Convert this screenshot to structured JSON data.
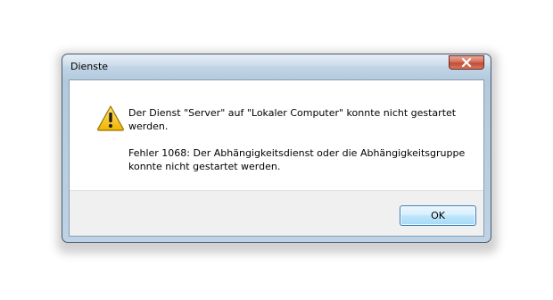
{
  "window": {
    "title": "Dienste"
  },
  "message": {
    "line1": "Der Dienst \"Server\" auf \"Lokaler Computer\" konnte nicht gestartet werden.",
    "line2": "Fehler 1068: Der Abhängigkeitsdienst oder die Abhängigkeitsgruppe konnte nicht gestartet werden."
  },
  "buttons": {
    "ok": "OK"
  },
  "icons": {
    "warning": "warning-icon",
    "close": "close-icon"
  },
  "colors": {
    "close_button": "#c44a35",
    "ok_border": "#3c7fb1",
    "warning_fill": "#f5c21b"
  }
}
